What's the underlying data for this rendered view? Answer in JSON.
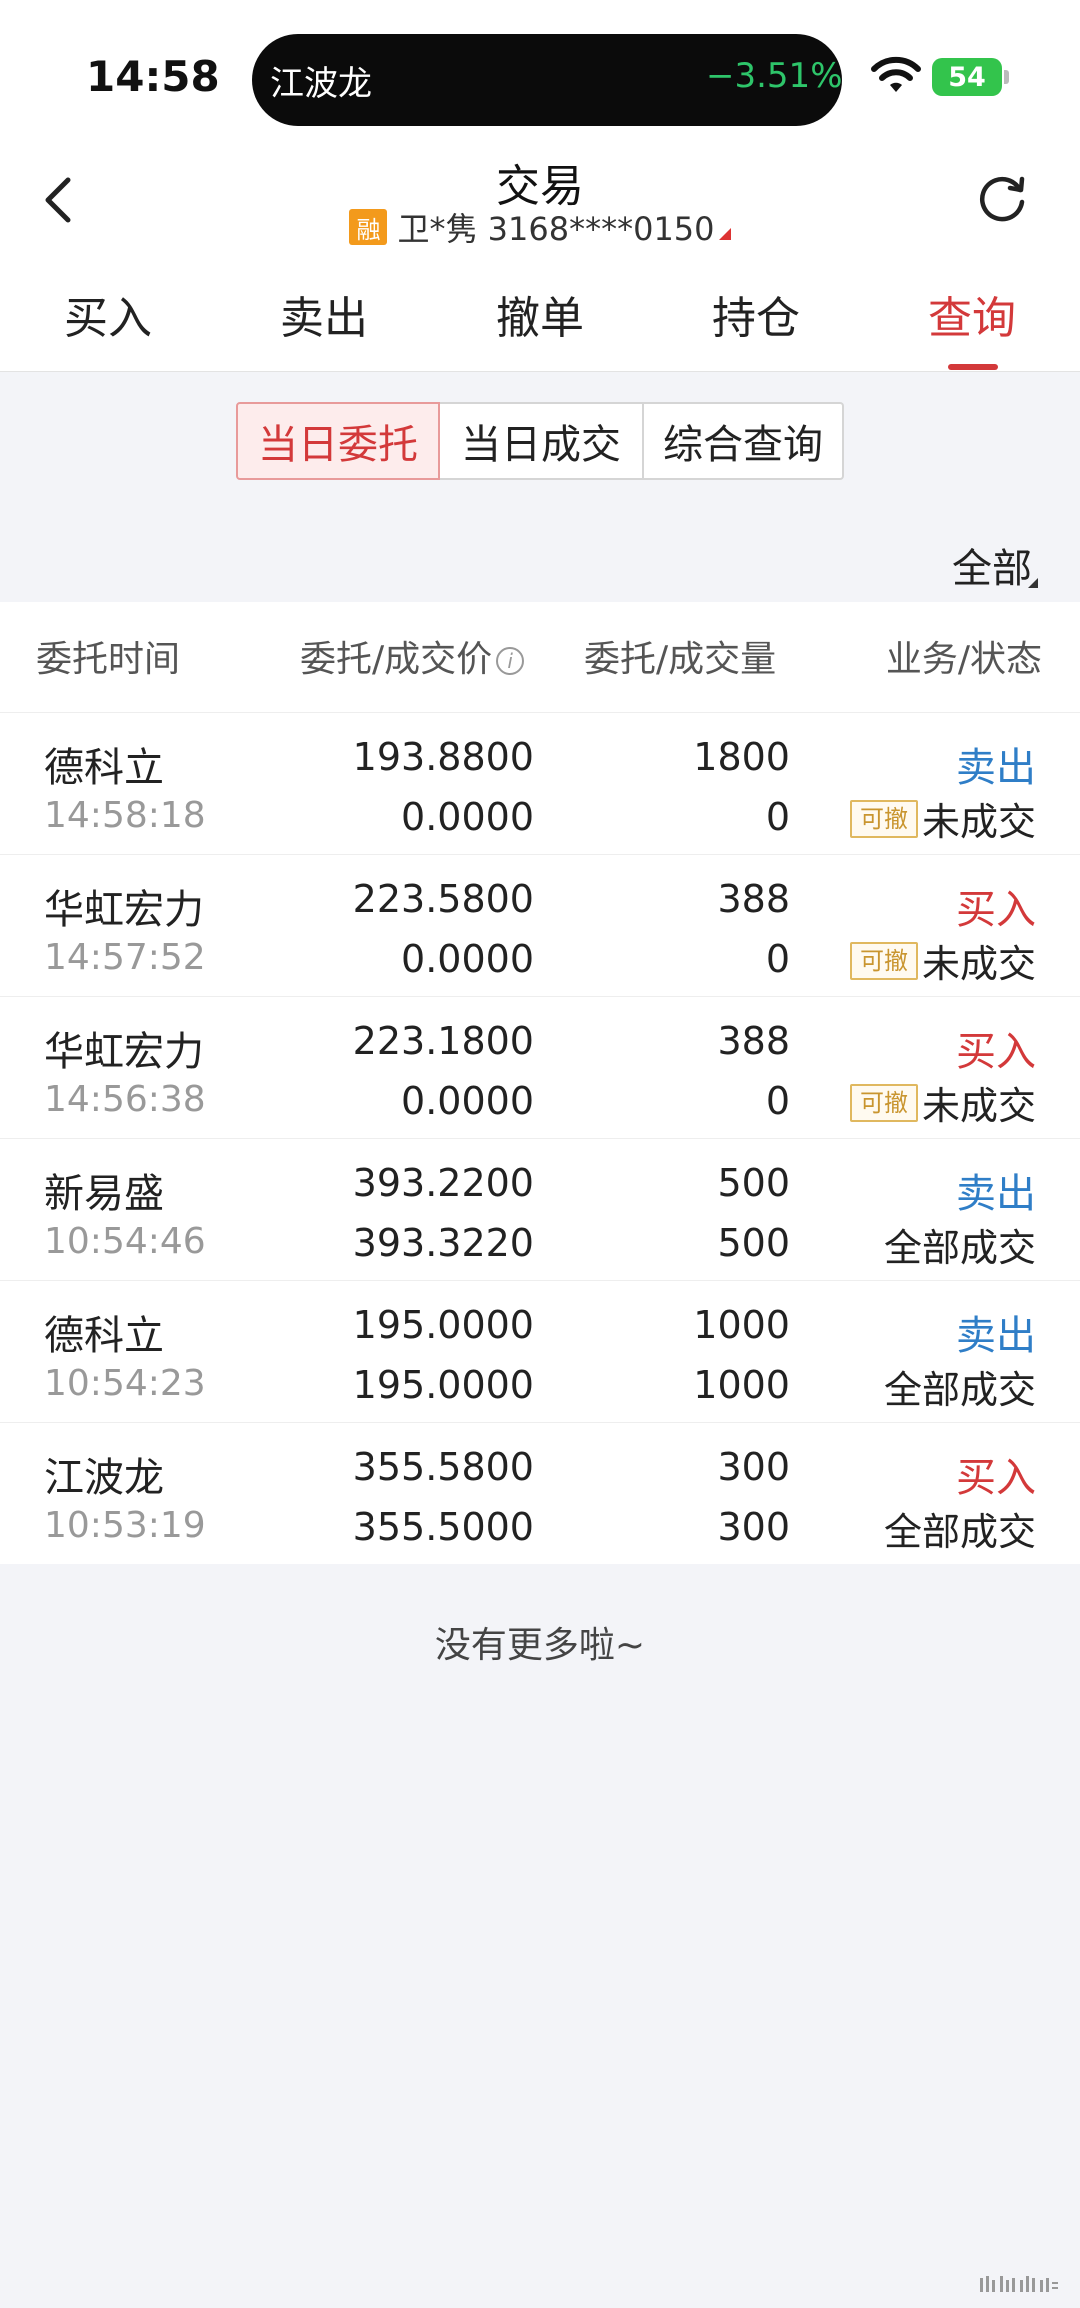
{
  "status_bar": {
    "time": "14:58",
    "island_stock": "江波龙",
    "island_change": "−3.51%",
    "battery": "54"
  },
  "header": {
    "title": "交易",
    "badge": "融",
    "account": "卫*隽 3168****0150"
  },
  "tabs": [
    {
      "label": "买入"
    },
    {
      "label": "卖出"
    },
    {
      "label": "撤单"
    },
    {
      "label": "持仓"
    },
    {
      "label": "查询",
      "active": true
    }
  ],
  "segments": [
    {
      "label": "当日委托",
      "active": true
    },
    {
      "label": "当日成交"
    },
    {
      "label": "综合查询"
    }
  ],
  "filter": "全部",
  "table": {
    "headers": [
      "委托时间",
      "委托/成交价",
      "委托/成交量",
      "业务/状态"
    ],
    "rows": [
      {
        "name": "德科立",
        "time": "14:58:18",
        "order_price": "193.8800",
        "deal_price": "0.0000",
        "order_qty": "1800",
        "deal_qty": "0",
        "biz": "卖出",
        "biz_type": "sell",
        "cancel": "可撤",
        "status": "未成交"
      },
      {
        "name": "华虹宏力",
        "time": "14:57:52",
        "order_price": "223.5800",
        "deal_price": "0.0000",
        "order_qty": "388",
        "deal_qty": "0",
        "biz": "买入",
        "biz_type": "buy",
        "cancel": "可撤",
        "status": "未成交"
      },
      {
        "name": "华虹宏力",
        "time": "14:56:38",
        "order_price": "223.1800",
        "deal_price": "0.0000",
        "order_qty": "388",
        "deal_qty": "0",
        "biz": "买入",
        "biz_type": "buy",
        "cancel": "可撤",
        "status": "未成交"
      },
      {
        "name": "新易盛",
        "time": "10:54:46",
        "order_price": "393.2200",
        "deal_price": "393.3220",
        "order_qty": "500",
        "deal_qty": "500",
        "biz": "卖出",
        "biz_type": "sell",
        "cancel": "",
        "status": "全部成交"
      },
      {
        "name": "德科立",
        "time": "10:54:23",
        "order_price": "195.0000",
        "deal_price": "195.0000",
        "order_qty": "1000",
        "deal_qty": "1000",
        "biz": "卖出",
        "biz_type": "sell",
        "cancel": "",
        "status": "全部成交"
      },
      {
        "name": "江波龙",
        "time": "10:53:19",
        "order_price": "355.5800",
        "deal_price": "355.5000",
        "order_qty": "300",
        "deal_qty": "300",
        "biz": "买入",
        "biz_type": "buy",
        "cancel": "",
        "status": "全部成交"
      }
    ]
  },
  "footer_text": "没有更多啦~",
  "colors": {
    "accent_red": "#d3393a",
    "sell_blue": "#2f7ec7",
    "gain_green": "#2ec56a",
    "badge_orange": "#f39a1c"
  }
}
